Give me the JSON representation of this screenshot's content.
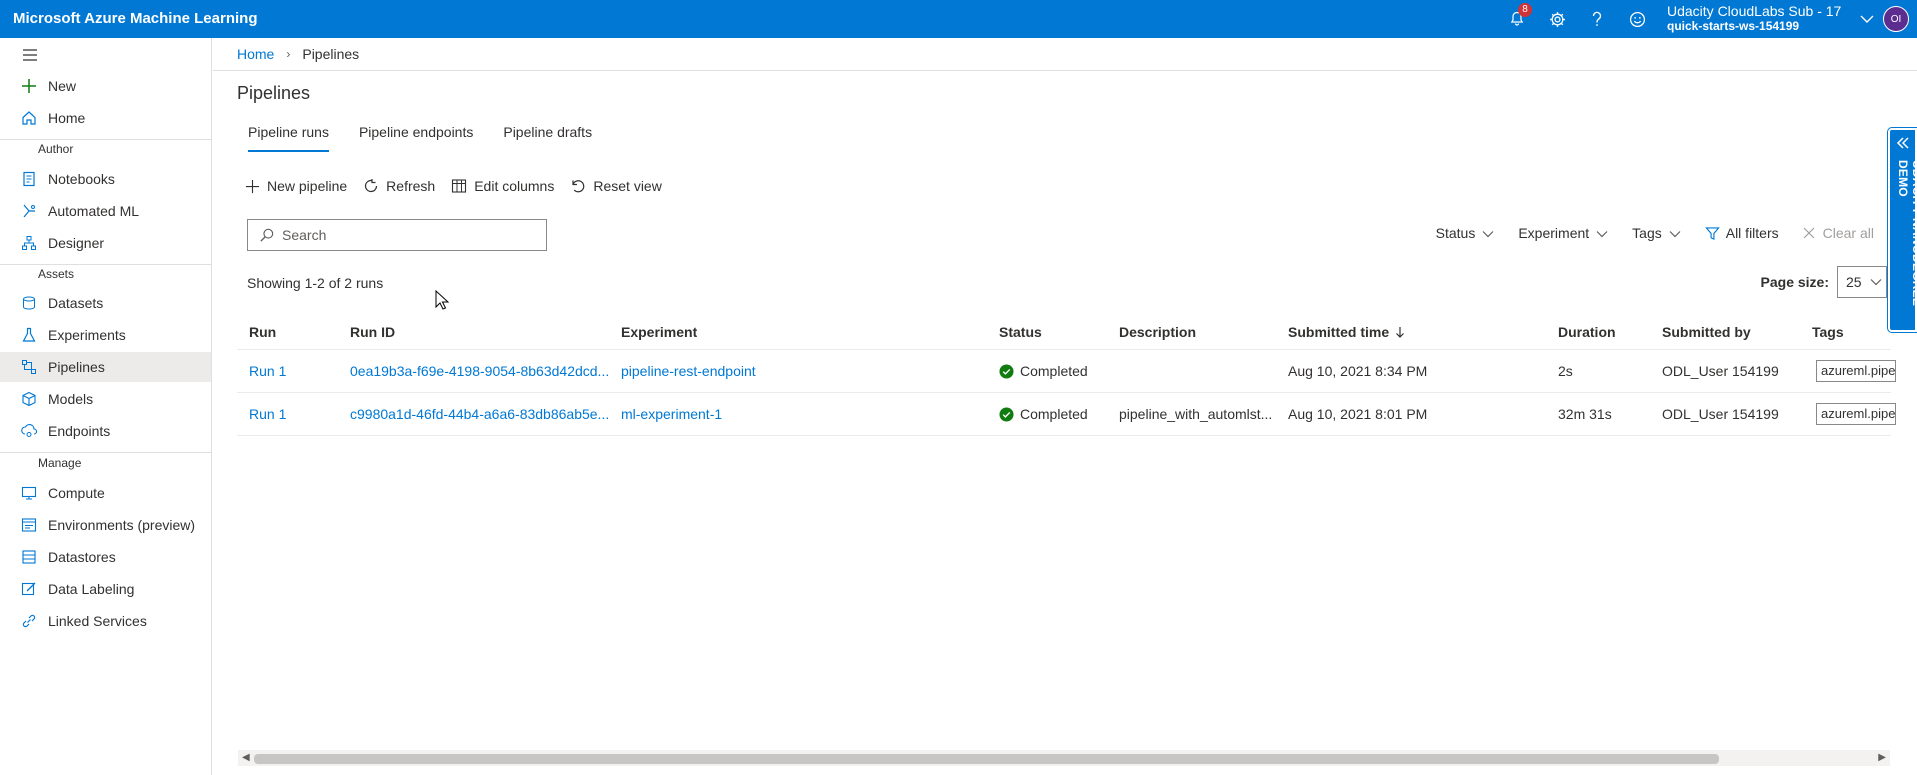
{
  "topbar": {
    "brand": "Microsoft Azure Machine Learning",
    "notification_count": "8",
    "account_name": "Udacity CloudLabs Sub - 17",
    "workspace": "quick-starts-ws-154199",
    "avatar_initials": "OI"
  },
  "sidebar": {
    "new_label": "New",
    "home_label": "Home",
    "author_header": "Author",
    "notebooks_label": "Notebooks",
    "automl_label": "Automated ML",
    "designer_label": "Designer",
    "assets_header": "Assets",
    "datasets_label": "Datasets",
    "experiments_label": "Experiments",
    "pipelines_label": "Pipelines",
    "models_label": "Models",
    "endpoints_label": "Endpoints",
    "manage_header": "Manage",
    "compute_label": "Compute",
    "environments_label": "Environments (preview)",
    "datastores_label": "Datastores",
    "datalabeling_label": "Data Labeling",
    "linked_label": "Linked Services"
  },
  "breadcrumb": {
    "home": "Home",
    "current": "Pipelines"
  },
  "page": {
    "title": "Pipelines"
  },
  "tabs": {
    "runs": "Pipeline runs",
    "endpoints": "Pipeline endpoints",
    "drafts": "Pipeline drafts"
  },
  "toolbar": {
    "new_pipeline": "New pipeline",
    "refresh": "Refresh",
    "edit_columns": "Edit columns",
    "reset_view": "Reset view"
  },
  "search": {
    "placeholder": "Search"
  },
  "filters": {
    "status": "Status",
    "experiment": "Experiment",
    "tags": "Tags",
    "all_filters": "All filters",
    "clear_all": "Clear all"
  },
  "summary": {
    "showing": "Showing 1-2 of 2 runs",
    "page_size_label": "Page size:",
    "page_size_value": "25"
  },
  "table": {
    "headers": {
      "run": "Run",
      "run_id": "Run ID",
      "experiment": "Experiment",
      "status": "Status",
      "description": "Description",
      "submitted_time": "Submitted time",
      "duration": "Duration",
      "submitted_by": "Submitted by",
      "tags": "Tags"
    },
    "rows": [
      {
        "run": "Run 1",
        "run_id": "0ea19b3a-f69e-4198-9054-8b63d42dcd...",
        "experiment": "pipeline-rest-endpoint",
        "status": "Completed",
        "description": "",
        "submitted_time": "Aug 10, 2021 8:34 PM",
        "duration": "2s",
        "submitted_by": "ODL_User 154199",
        "tags": "azureml.pipe"
      },
      {
        "run": "Run 1",
        "run_id": "c9980a1d-46fd-44b4-a6a6-83db86ab5e...",
        "experiment": "ml-experiment-1",
        "status": "Completed",
        "description": "pipeline_with_automlst...",
        "submitted_time": "Aug 10, 2021 8:01 PM",
        "duration": "32m 31s",
        "submitted_by": "ODL_User 154199",
        "tags": "azureml.pipe"
      }
    ]
  },
  "side_panel": {
    "label": "UDACITY NANODEGREE DEMO"
  },
  "colors": {
    "accent": "#0078d4",
    "success": "#107c10",
    "badge": "#d13438"
  }
}
